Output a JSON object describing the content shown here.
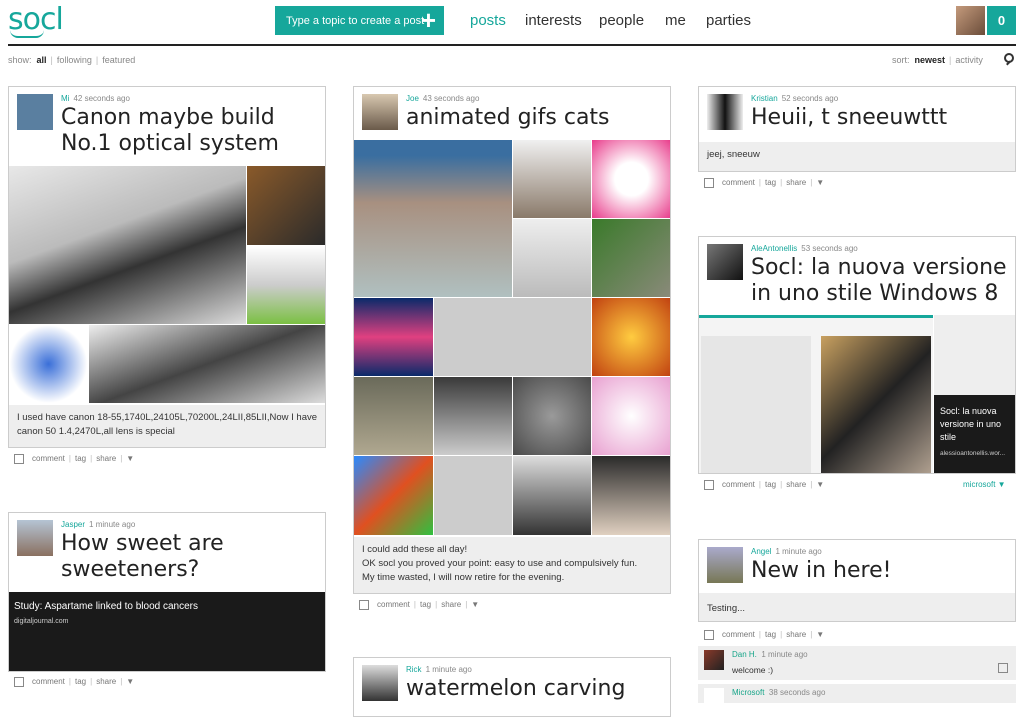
{
  "header": {
    "logo": "socl",
    "create_label": "Type a topic to create a post",
    "create_icon": "+",
    "nav": [
      "posts",
      "interests",
      "people",
      "me",
      "parties"
    ],
    "count": "0"
  },
  "filter": {
    "show_label": "show:",
    "show_options": [
      "all",
      "following",
      "featured"
    ],
    "sort_label": "sort:",
    "sort_options": [
      "newest",
      "activity"
    ]
  },
  "cards": {
    "canon": {
      "name": "Mi",
      "time": "42 seconds ago",
      "title": "Canon maybe build No.1 optical system",
      "text": "I used have canon 18-55,1740L,24105L,70200L,24LII,85LII,Now I have canon 50 1.4,2470L,all lens is special"
    },
    "cats": {
      "name": "Joe",
      "time": "43 seconds ago",
      "title": "animated gifs cats",
      "text_lines": [
        "I could add these all day!",
        "OK socl you proved your point: easy to use and compulsively fun.",
        "My time wasted, I will now retire for the evening."
      ]
    },
    "kristian": {
      "name": "Kristian",
      "time": "52 seconds ago",
      "title": "Heuii, t sneeuwttt",
      "text": "jeej, sneeuw"
    },
    "ale": {
      "name": "AleAntonellis",
      "time": "53 seconds ago",
      "title": "Socl: la nuova versione in uno stile Windows 8",
      "preview_caption": "Socl: la nuova versione in uno stile",
      "preview_url": "alessioantonellis.wor...",
      "source": "microsoft"
    },
    "jasper": {
      "name": "Jasper",
      "time": "1 minute ago",
      "title": "How sweet are sweeteners?",
      "link_title": "Study: Aspartame linked to blood cancers",
      "link_domain": "digitaljournal.com"
    },
    "rick": {
      "name": "Rick",
      "time": "1 minute ago",
      "title": "watermelon carving"
    },
    "angel": {
      "name": "Angel",
      "time": "1 minute ago",
      "title": "New in here!",
      "text": "Testing...",
      "comments": [
        {
          "name": "Dan H.",
          "time": "1 minute ago",
          "text": "welcome :)"
        },
        {
          "name": "Microsoft",
          "time": "38 seconds ago"
        }
      ]
    }
  },
  "actions": {
    "comment": "comment",
    "tag": "tag",
    "share": "share",
    "more": "▼"
  }
}
